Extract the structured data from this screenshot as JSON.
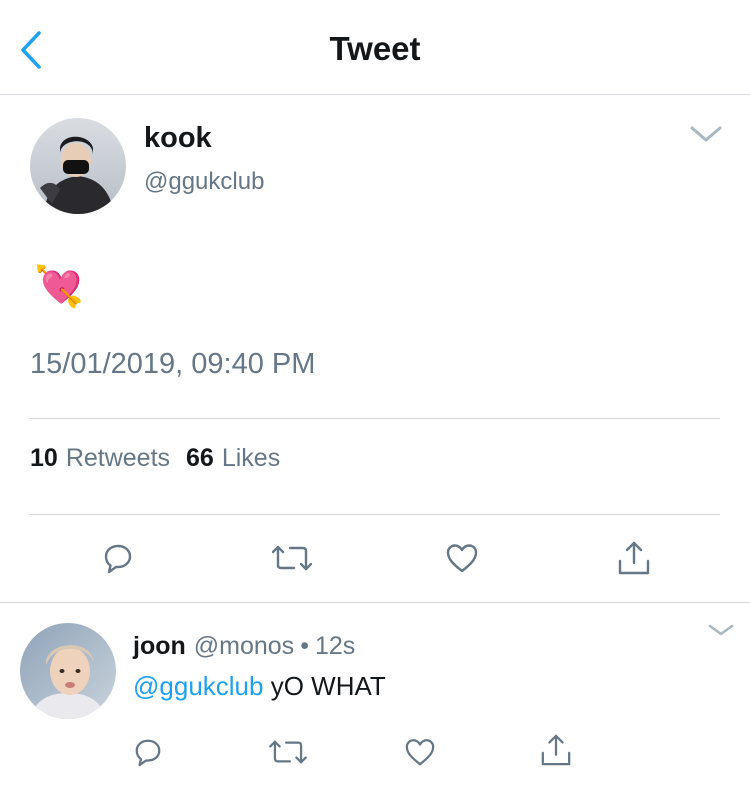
{
  "header": {
    "title": "Tweet",
    "back_icon": "chevron-left-icon"
  },
  "tweet": {
    "author": {
      "name": "kook",
      "handle": "@ggukclub"
    },
    "text": "💘",
    "timestamp": "15/01/2019, 09:40 PM",
    "stats": {
      "retweets_count": "10",
      "retweets_label": "Retweets",
      "likes_count": "66",
      "likes_label": "Likes"
    },
    "actions": [
      "reply-icon",
      "retweet-icon",
      "heart-icon",
      "share-icon"
    ]
  },
  "reply": {
    "name": "joon",
    "handle": "@monos",
    "separator": "•",
    "time": "12s",
    "mention": "@ggukclub",
    "text": "yO WHAT",
    "actions": [
      "reply-icon",
      "retweet-icon",
      "heart-icon",
      "share-icon"
    ]
  },
  "colors": {
    "accent": "#1da1f2",
    "text_primary": "#14171a",
    "text_secondary": "#657786",
    "divider": "#d5d9dd"
  }
}
